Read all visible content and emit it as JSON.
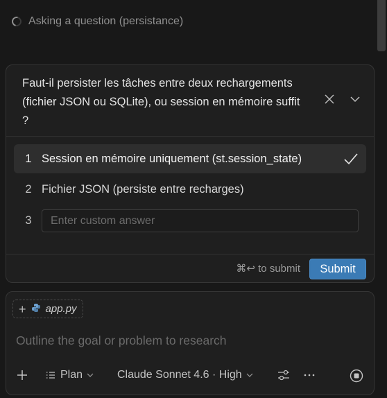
{
  "status": {
    "text": "Asking a question (persistance)"
  },
  "question": {
    "text": "Faut-il persister les tâches entre deux rechargements (fichier JSON ou SQLite), ou session en mémoire suffit ?",
    "options": [
      {
        "number": "1",
        "label": "Session en mémoire uniquement (st.session_state)",
        "selected": true
      },
      {
        "number": "2",
        "label": "Fichier JSON (persiste entre recharges)",
        "selected": false
      }
    ],
    "custom": {
      "number": "3",
      "placeholder": "Enter custom answer",
      "value": ""
    },
    "shortcut_hint": "⌘↩ to submit",
    "submit_label": "Submit"
  },
  "composer": {
    "attachment": {
      "name": "app.py",
      "icon": "python-icon"
    },
    "placeholder": "Outline the goal or problem to research",
    "mode_label": "Plan",
    "model_label": "Claude Sonnet 4.6 · High"
  },
  "colors": {
    "background": "#181818",
    "panel": "#1f1f1f",
    "accent": "#3b7bb5"
  }
}
